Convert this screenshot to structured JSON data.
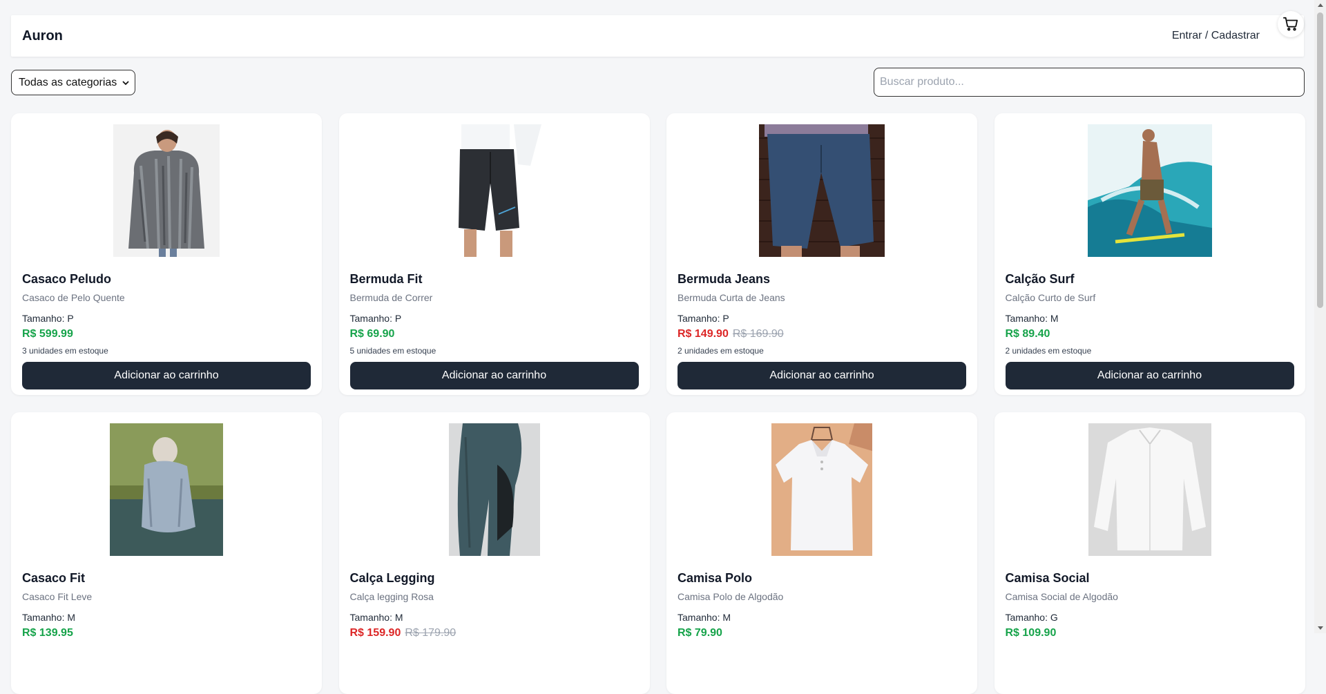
{
  "header": {
    "brand": "Auron",
    "login_label": "Entrar / Cadastrar",
    "cart_icon": "cart-icon"
  },
  "filters": {
    "category_selected": "Todas as categorias",
    "search_placeholder": "Buscar produto..."
  },
  "colors": {
    "price_normal": "#16a34a",
    "price_sale": "#dc2626",
    "button_bg": "#1f2937"
  },
  "products": [
    {
      "name": "Casaco Peludo",
      "description": "Casaco de Pelo Quente",
      "size": "Tamanho: P",
      "price": "R$ 599.99",
      "old_price": "",
      "stock": "3 unidades em estoque",
      "button": "Adicionar ao carrinho"
    },
    {
      "name": "Bermuda Fit",
      "description": "Bermuda de Correr",
      "size": "Tamanho: P",
      "price": "R$ 69.90",
      "old_price": "",
      "stock": "5 unidades em estoque",
      "button": "Adicionar ao carrinho"
    },
    {
      "name": "Bermuda Jeans",
      "description": "Bermuda Curta de Jeans",
      "size": "Tamanho: P",
      "price": "R$ 149.90",
      "old_price": "R$ 169.90",
      "stock": "2 unidades em estoque",
      "button": "Adicionar ao carrinho"
    },
    {
      "name": "Calção Surf",
      "description": "Calção Curto de Surf",
      "size": "Tamanho: M",
      "price": "R$ 89.40",
      "old_price": "",
      "stock": "2 unidades em estoque",
      "button": "Adicionar ao carrinho"
    },
    {
      "name": "Casaco Fit",
      "description": "Casaco Fit Leve",
      "size": "Tamanho: M",
      "price": "R$ 139.95",
      "old_price": "",
      "stock": "",
      "button": ""
    },
    {
      "name": "Calça Legging",
      "description": "Calça legging Rosa",
      "size": "Tamanho: M",
      "price": "R$ 159.90",
      "old_price": "R$ 179.90",
      "stock": "",
      "button": ""
    },
    {
      "name": "Camisa Polo",
      "description": "Camisa Polo de Algodão",
      "size": "Tamanho: M",
      "price": "R$ 79.90",
      "old_price": "",
      "stock": "",
      "button": ""
    },
    {
      "name": "Camisa Social",
      "description": "Camisa Social de Algodão",
      "size": "Tamanho: G",
      "price": "R$ 109.90",
      "old_price": "",
      "stock": "",
      "button": ""
    }
  ]
}
